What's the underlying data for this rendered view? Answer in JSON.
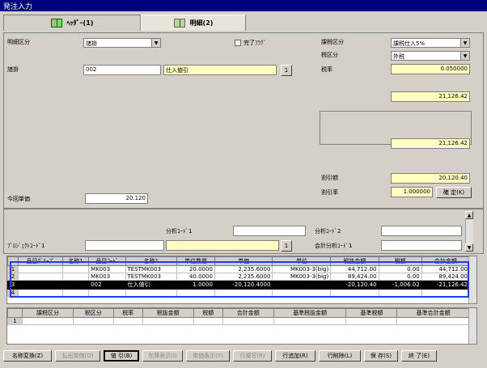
{
  "window": {
    "title": "発注入力"
  },
  "tabs": [
    {
      "label": "ﾍｯﾀﾞｰ(1)"
    },
    {
      "label": "明細(2)"
    }
  ],
  "detail": {
    "meisai_kubun_label": "明細区分",
    "meisai_kubun_value": "諸掛",
    "kanryo_flag_label": "完了ﾌﾗｸﾞ",
    "kazei_kubun_label": "課税区分",
    "kazei_kubun_value": "課税仕入5%",
    "zeikubun_label": "税区分",
    "zeikubun_value": "外税",
    "shokake_label": "諸掛",
    "shokake_code": "002",
    "shokake_name": "仕入値引",
    "btn_1": "1",
    "zeiritsu_label": "税率",
    "zeiritsu_value": "0.050000",
    "amount1": "21,126.42",
    "amount2": "21,126.42",
    "waribiki_gaku_label": "割引額",
    "waribiki_gaku_value": "20,120.40",
    "waribiki_ritsu_label": "割引率",
    "waribiki_ritsu_value": "1.000000",
    "kakutei_label": "確 定(K)",
    "konkai_tanka_label": "今回単価",
    "konkai_tanka_value": "20.120",
    "bunseki1_label": "分析ｺｰﾄﾞ1",
    "bunseki2_label": "分析ｺｰﾄﾞ2",
    "project1_label": "ﾌﾟﾛｼﾞｪｸﾄｺｰﾄﾞ1",
    "kaikei_bunseki1_label": "会計分析ｺｰﾄﾞ1"
  },
  "grid": {
    "headers": [
      "",
      "品目ｸﾞﾙｰﾌﾟ",
      "名称1",
      "品目ｺｰﾄﾞ",
      "名称1",
      "単位数量",
      "単価",
      "単位",
      "税抜金額",
      "税額",
      "合計金額"
    ],
    "rows": [
      [
        "1",
        "",
        "",
        "MK003",
        "TESTMK003",
        "20.0000",
        "2,235.6000",
        "MK003-3(big)",
        "44,712.00",
        "0.00",
        "44,712.00"
      ],
      [
        "2",
        "",
        "",
        "MK003",
        "TESTMK003",
        "40.0000",
        "2,235.6000",
        "MK003-3(big)",
        "89,424.00",
        "0.00",
        "89,424.00"
      ],
      [
        "3",
        "",
        "",
        "002",
        "仕入値引",
        "1.0000",
        "-20,120.4000",
        "",
        "-20,120.40",
        "-1,006.02",
        "-21,126.42"
      ],
      [
        "4",
        "",
        "",
        "",
        "",
        "",
        "",
        "",
        "",
        "",
        ""
      ]
    ]
  },
  "grid2": {
    "headers": [
      "",
      "課税区分",
      "税区分",
      "税率",
      "税抜金額",
      "税額",
      "合計金額",
      "基準税抜金額",
      "基準税額",
      "基準合計金額"
    ],
    "rows": [
      [
        "1",
        "",
        "",
        "",
        "",
        "",
        "",
        "",
        "",
        ""
      ]
    ]
  },
  "buttons": [
    {
      "label": "名称変換(Z)"
    },
    {
      "label": "払出単価(O)"
    },
    {
      "label": "値 引(B)"
    },
    {
      "label": "在庫表示(I)"
    },
    {
      "label": "単価表示(Y)"
    },
    {
      "label": "行複写(R)"
    },
    {
      "label": "行追加(R)"
    },
    {
      "label": "行削除(L)"
    },
    {
      "label": "保 存(S)"
    },
    {
      "label": "終 了(E)"
    }
  ]
}
